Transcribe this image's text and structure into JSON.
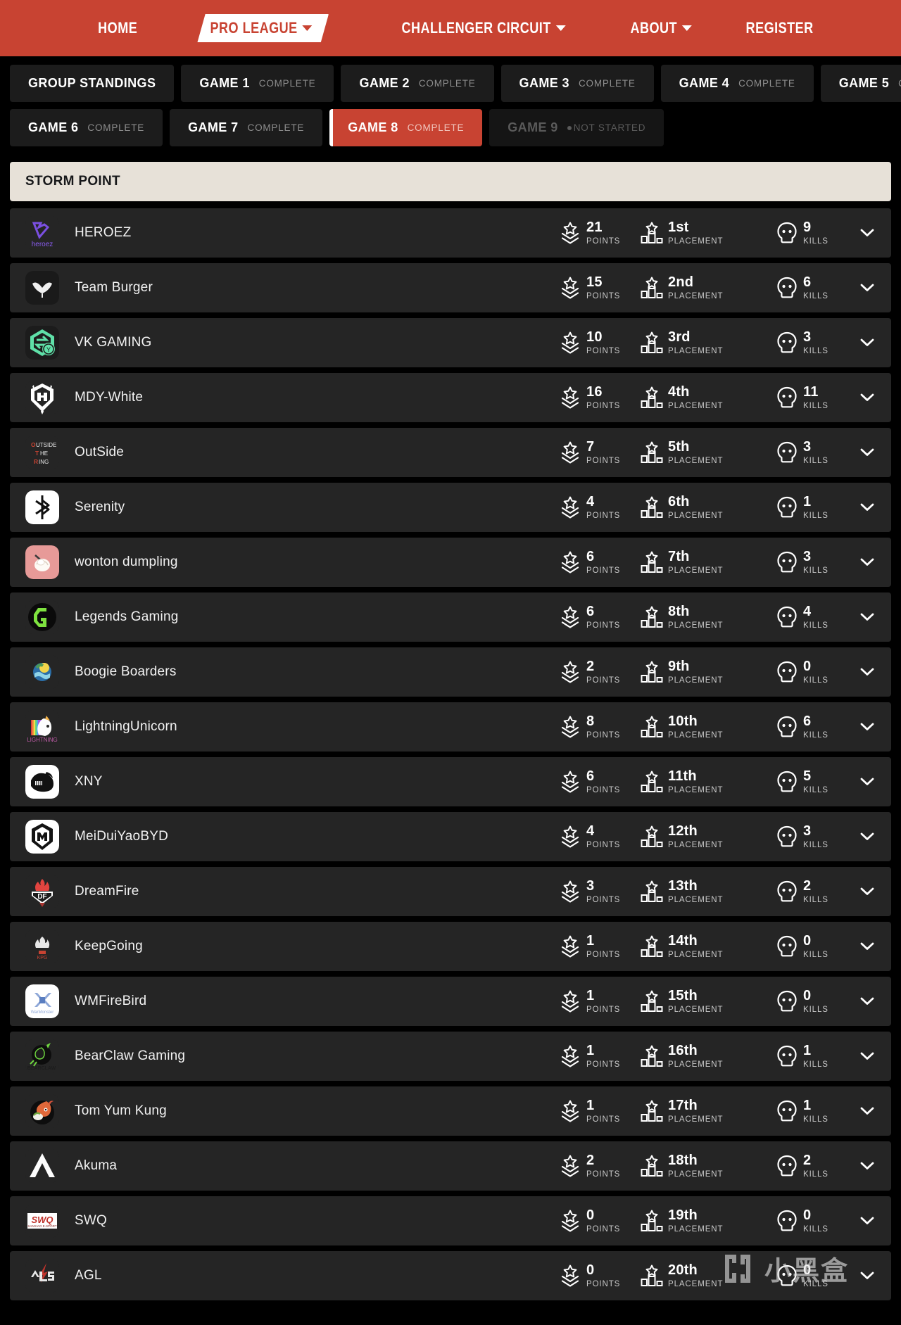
{
  "nav": {
    "items": [
      {
        "label": "HOME",
        "has_caret": false,
        "active": false
      },
      {
        "label": "PRO LEAGUE",
        "has_caret": true,
        "active": true
      },
      {
        "label": "CHALLENGER CIRCUIT",
        "has_caret": true,
        "active": false
      },
      {
        "label": "ABOUT",
        "has_caret": true,
        "active": false
      },
      {
        "label": "REGISTER",
        "has_caret": false,
        "active": false
      }
    ],
    "brand_color": "#c84332"
  },
  "tabs": {
    "row1": [
      {
        "title": "GROUP STANDINGS",
        "status": "",
        "state": "normal"
      },
      {
        "title": "GAME 1",
        "status": "COMPLETE",
        "state": "normal"
      },
      {
        "title": "GAME 2",
        "status": "COMPLETE",
        "state": "normal"
      },
      {
        "title": "GAME 3",
        "status": "COMPLETE",
        "state": "normal"
      },
      {
        "title": "GAME 4",
        "status": "COMPLETE",
        "state": "normal"
      },
      {
        "title": "GAME 5",
        "status": "COMPLETE",
        "state": "normal"
      }
    ],
    "row2": [
      {
        "title": "GAME 6",
        "status": "COMPLETE",
        "state": "normal"
      },
      {
        "title": "GAME 7",
        "status": "COMPLETE",
        "state": "normal"
      },
      {
        "title": "GAME 8",
        "status": "COMPLETE",
        "state": "active"
      },
      {
        "title": "GAME 9",
        "status": "NOT STARTED",
        "state": "disabled"
      }
    ]
  },
  "map_header": {
    "name": "STORM POINT"
  },
  "stat_labels": {
    "points": "POINTS",
    "placement": "PLACEMENT",
    "kills": "KILLS"
  },
  "teams": [
    {
      "name": "HEROEZ",
      "points": "21",
      "placement": "1st",
      "kills": "9",
      "logo": "heroez"
    },
    {
      "name": "Team Burger",
      "points": "15",
      "placement": "2nd",
      "kills": "6",
      "logo": "burger"
    },
    {
      "name": "VK GAMING",
      "points": "10",
      "placement": "3rd",
      "kills": "3",
      "logo": "vk"
    },
    {
      "name": "MDY-White",
      "points": "16",
      "placement": "4th",
      "kills": "11",
      "logo": "mdy"
    },
    {
      "name": "OutSide",
      "points": "7",
      "placement": "5th",
      "kills": "3",
      "logo": "outside"
    },
    {
      "name": "Serenity",
      "points": "4",
      "placement": "6th",
      "kills": "1",
      "logo": "serenity"
    },
    {
      "name": "wonton dumpling",
      "points": "6",
      "placement": "7th",
      "kills": "3",
      "logo": "wonton"
    },
    {
      "name": "Legends Gaming",
      "points": "6",
      "placement": "8th",
      "kills": "4",
      "logo": "legends"
    },
    {
      "name": "Boogie Boarders",
      "points": "2",
      "placement": "9th",
      "kills": "0",
      "logo": "boogie"
    },
    {
      "name": "LightningUnicorn",
      "points": "8",
      "placement": "10th",
      "kills": "6",
      "logo": "unicorn"
    },
    {
      "name": "XNY",
      "points": "6",
      "placement": "11th",
      "kills": "5",
      "logo": "xny"
    },
    {
      "name": "MeiDuiYaoBYD",
      "points": "4",
      "placement": "12th",
      "kills": "3",
      "logo": "mdy2"
    },
    {
      "name": "DreamFire",
      "points": "3",
      "placement": "13th",
      "kills": "2",
      "logo": "dreamfire"
    },
    {
      "name": "KeepGoing",
      "points": "1",
      "placement": "14th",
      "kills": "0",
      "logo": "keepgoing"
    },
    {
      "name": "WMFireBird",
      "points": "1",
      "placement": "15th",
      "kills": "0",
      "logo": "wmfirebird"
    },
    {
      "name": "BearClaw Gaming",
      "points": "1",
      "placement": "16th",
      "kills": "1",
      "logo": "bearclaw"
    },
    {
      "name": "Tom Yum Kung",
      "points": "1",
      "placement": "17th",
      "kills": "1",
      "logo": "tomyum"
    },
    {
      "name": "Akuma",
      "points": "2",
      "placement": "18th",
      "kills": "2",
      "logo": "akuma"
    },
    {
      "name": "SWQ",
      "points": "0",
      "placement": "19th",
      "kills": "0",
      "logo": "swq"
    },
    {
      "name": "AGL",
      "points": "0",
      "placement": "20th",
      "kills": "0",
      "logo": "agl"
    }
  ],
  "watermark": {
    "text": "小黑盒"
  }
}
